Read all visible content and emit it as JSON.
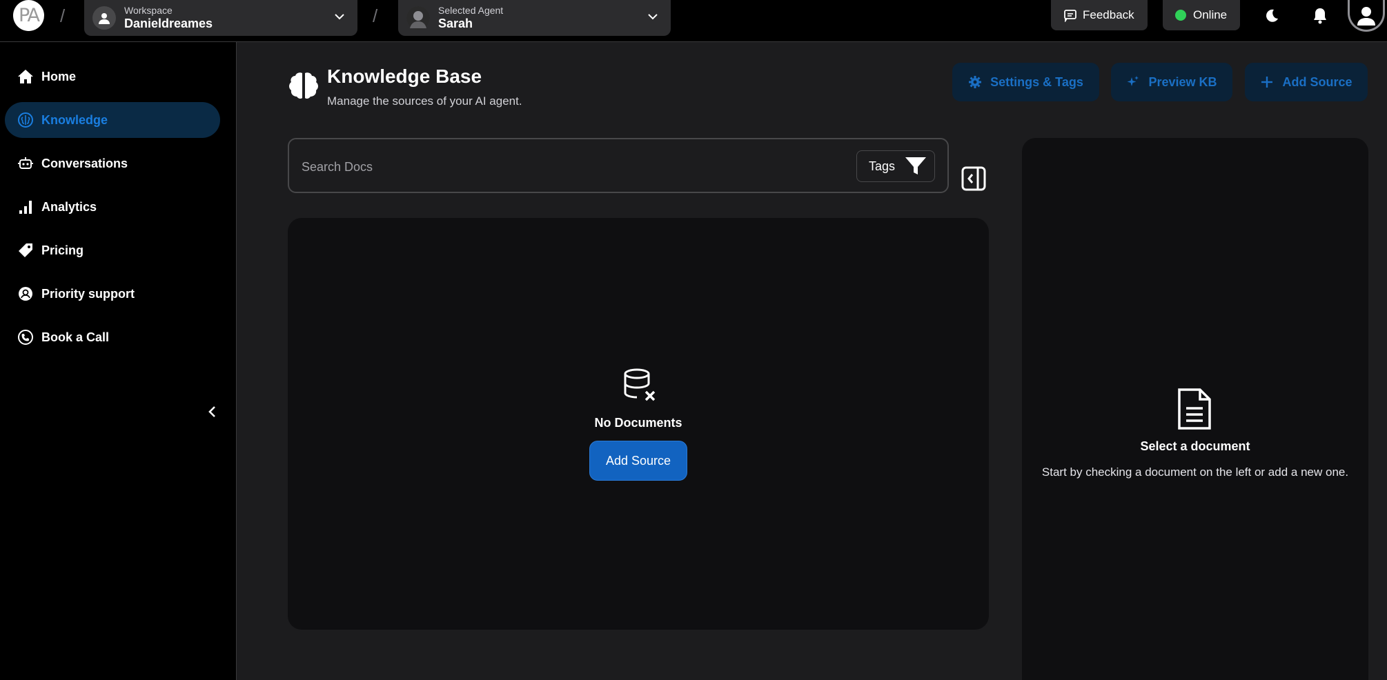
{
  "topbar": {
    "logo_text": "PA",
    "separator": "/",
    "workspace": {
      "label": "Workspace",
      "value": "Danieldreames"
    },
    "agent": {
      "label": "Selected Agent",
      "value": "Sarah"
    },
    "feedback_label": "Feedback",
    "status_label": "Online",
    "status_color": "#30d158"
  },
  "sidebar": {
    "items": [
      {
        "label": "Home",
        "icon": "home-icon"
      },
      {
        "label": "Knowledge",
        "icon": "brain-icon",
        "active": true
      },
      {
        "label": "Conversations",
        "icon": "bot-icon"
      },
      {
        "label": "Analytics",
        "icon": "bar-chart-icon"
      },
      {
        "label": "Pricing",
        "icon": "tag-icon"
      },
      {
        "label": "Priority support",
        "icon": "support-icon"
      },
      {
        "label": "Book a Call",
        "icon": "phone-icon"
      }
    ]
  },
  "header": {
    "title": "Knowledge Base",
    "subtitle": "Manage the sources of your AI agent.",
    "settings_label": "Settings & Tags",
    "preview_label": "Preview KB",
    "add_source_label": "Add Source"
  },
  "search": {
    "placeholder": "Search Docs",
    "tags_label": "Tags"
  },
  "documents": {
    "empty_title": "No Documents",
    "add_source_label": "Add Source"
  },
  "detail": {
    "title": "Select a document",
    "subtitle": "Start by checking a document on the left or add a new one."
  },
  "colors": {
    "accent": "#1263c0",
    "accent_text": "#1a6fc4",
    "active_nav_bg": "#0a2a45",
    "background": "#1c1c1e",
    "panel": "#0f0f11"
  }
}
